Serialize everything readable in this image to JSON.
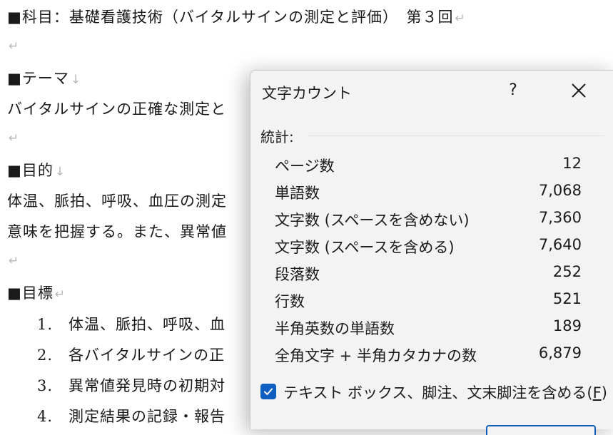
{
  "document": {
    "subject_line": "■科目：基礎看護技術（バイタルサインの測定と評価）　第３回",
    "theme_heading": "■テーマ",
    "theme_text": "バイタルサインの正確な測定と",
    "purpose_heading": "■目的",
    "purpose_line1": "体温、脈拍、呼吸、血圧の測定",
    "purpose_line2": "意味を把握する。また、異常値",
    "goals_heading": "■目標",
    "goals": [
      {
        "num": "1.",
        "text": "体温、脈拍、呼吸、血"
      },
      {
        "num": "2.",
        "text": "各バイタルサインの正"
      },
      {
        "num": "3.",
        "text": "異常値発見時の初期対"
      },
      {
        "num": "4.",
        "text": "測定結果の記録・報告"
      }
    ],
    "paragraph_mark": "↵",
    "line_break_mark": "↓"
  },
  "dialog": {
    "title": "文字カウント",
    "help_label": "?",
    "stats_label": "統計:",
    "rows": [
      {
        "label": "ページ数",
        "value": "12"
      },
      {
        "label": "単語数",
        "value": "7,068"
      },
      {
        "label": "文字数 (スペースを含めない)",
        "value": "7,360"
      },
      {
        "label": "文字数 (スペースを含める)",
        "value": "7,640"
      },
      {
        "label": "段落数",
        "value": "252"
      },
      {
        "label": "行数",
        "value": "521"
      },
      {
        "label": "半角英数の単語数",
        "value": "189"
      },
      {
        "label": "全角文字 + 半角カタカナの数",
        "value": "6,879"
      }
    ],
    "checkbox_label": "テキスト ボックス、脚注、文末脚注を含める(",
    "checkbox_accel": "F",
    "checkbox_label_end": ")",
    "checkbox_checked": true,
    "accent_color": "#0f5fc0"
  }
}
